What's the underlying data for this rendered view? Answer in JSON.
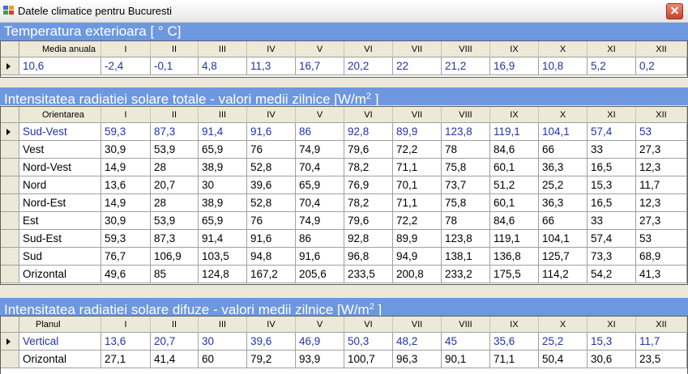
{
  "window": {
    "title": "Datele climatice pentru Bucuresti",
    "close_label": "✕"
  },
  "months": [
    "I",
    "II",
    "III",
    "IV",
    "V",
    "VI",
    "VII",
    "VIII",
    "IX",
    "X",
    "XI",
    "XII"
  ],
  "temperature": {
    "title": "Temperatura exterioara [ ° C]",
    "first_col": "Media anuala",
    "rows": [
      {
        "label": "10,6",
        "values": [
          "-2,4",
          "-0,1",
          "4,8",
          "11,3",
          "16,7",
          "20,2",
          "22",
          "21,2",
          "16,9",
          "10,8",
          "5,2",
          "0,2"
        ]
      }
    ]
  },
  "total_radiation": {
    "title_main": "Intensitatea radiatiei solare totale - valori medii zilnice [W/m",
    "title_sup": "2",
    "title_end": "]",
    "first_col": "Orientarea",
    "rows": [
      {
        "label": "Sud-Vest",
        "values": [
          "59,3",
          "87,3",
          "91,4",
          "91,6",
          "86",
          "92,8",
          "89,9",
          "123,8",
          "119,1",
          "104,1",
          "57,4",
          "53"
        ]
      },
      {
        "label": "Vest",
        "values": [
          "30,9",
          "53,9",
          "65,9",
          "76",
          "74,9",
          "79,6",
          "72,2",
          "78",
          "84,6",
          "66",
          "33",
          "27,3"
        ]
      },
      {
        "label": "Nord-Vest",
        "values": [
          "14,9",
          "28",
          "38,9",
          "52,8",
          "70,4",
          "78,2",
          "71,1",
          "75,8",
          "60,1",
          "36,3",
          "16,5",
          "12,3"
        ]
      },
      {
        "label": "Nord",
        "values": [
          "13,6",
          "20,7",
          "30",
          "39,6",
          "65,9",
          "76,9",
          "70,1",
          "73,7",
          "51,2",
          "25,2",
          "15,3",
          "11,7"
        ]
      },
      {
        "label": "Nord-Est",
        "values": [
          "14,9",
          "28",
          "38,9",
          "52,8",
          "70,4",
          "78,2",
          "71,1",
          "75,8",
          "60,1",
          "36,3",
          "16,5",
          "12,3"
        ]
      },
      {
        "label": "Est",
        "values": [
          "30,9",
          "53,9",
          "65,9",
          "76",
          "74,9",
          "79,6",
          "72,2",
          "78",
          "84,6",
          "66",
          "33",
          "27,3"
        ]
      },
      {
        "label": "Sud-Est",
        "values": [
          "59,3",
          "87,3",
          "91,4",
          "91,6",
          "86",
          "92,8",
          "89,9",
          "123,8",
          "119,1",
          "104,1",
          "57,4",
          "53"
        ]
      },
      {
        "label": "Sud",
        "values": [
          "76,7",
          "106,9",
          "103,5",
          "94,8",
          "91,6",
          "96,8",
          "94,9",
          "138,1",
          "136,8",
          "125,7",
          "73,3",
          "68,9"
        ]
      },
      {
        "label": "Orizontal",
        "values": [
          "49,6",
          "85",
          "124,8",
          "167,2",
          "205,6",
          "233,5",
          "200,8",
          "233,2",
          "175,5",
          "114,2",
          "54,2",
          "41,3"
        ]
      }
    ]
  },
  "diffuse_radiation": {
    "title_main": "Intensitatea radiatiei solare difuze - valori medii zilnice [W/m",
    "title_sup": "2",
    "title_end": "]",
    "first_col": "Planul",
    "rows": [
      {
        "label": "Vertical",
        "values": [
          "13,6",
          "20,7",
          "30",
          "39,6",
          "46,9",
          "50,3",
          "48,2",
          "45",
          "35,6",
          "25,2",
          "15,3",
          "11,7"
        ]
      },
      {
        "label": "Orizontal",
        "values": [
          "27,1",
          "41,4",
          "60",
          "79,2",
          "93,9",
          "100,7",
          "96,3",
          "90,1",
          "71,1",
          "50,4",
          "30,6",
          "23,5"
        ]
      }
    ]
  },
  "colors": {
    "header_bg": "#6d98e0",
    "selected_text": "#2233aa",
    "window_bg": "#ece9d8"
  }
}
